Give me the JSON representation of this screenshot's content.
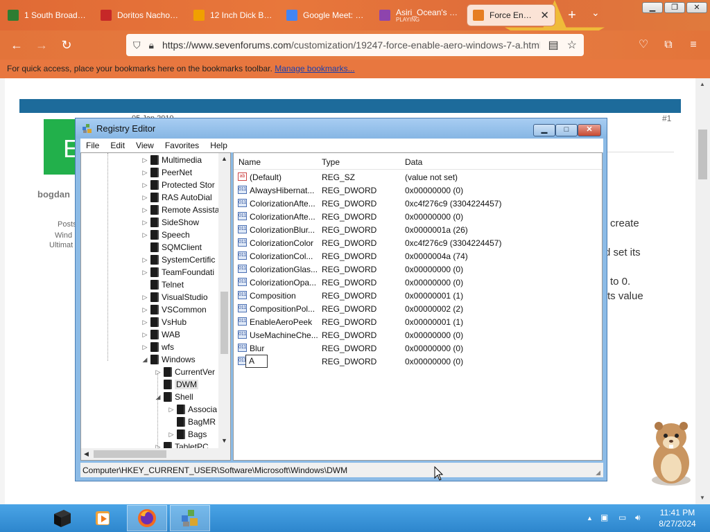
{
  "browser": {
    "tabs": [
      {
        "label": "1 South Broadway",
        "favicon": "green-square-icon",
        "color": "#2e7d32"
      },
      {
        "label": "Doritos Nacho Cheese",
        "favicon": "doritos-icon",
        "color": "#c62828"
      },
      {
        "label": "12 Inch Dick BBC",
        "favicon": "ph-icon",
        "color": "#f0a000"
      },
      {
        "label": "Google Meet: Online",
        "favicon": "google-icon",
        "color": "#4285f4"
      },
      {
        "label": "Asiri_Ocean's Room",
        "sublabel": "PLAYING",
        "favicon": "avatar-icon",
        "color": "#8e44ad"
      },
      {
        "label": "Force Enable Aero",
        "favicon": "sevenforums-icon",
        "color": "#e67e22",
        "active": true
      }
    ],
    "url_base": "https://www.sevenforums.com",
    "url_path": "/customization/19247-force-enable-aero-windows-7-a.html",
    "bookmarks_text": "For quick access, place your bookmarks here on the bookmarks toolbar.",
    "bookmarks_link": "Manage bookmarks..."
  },
  "page": {
    "post_number": "#1",
    "avatar_letter": "E",
    "date_partial": "05 Jan 2010",
    "username": "bogdan",
    "sidebar": [
      "Posts",
      "Wind",
      "Ultimat"
    ],
    "text_fragments": [
      "create",
      "d set its",
      "to 0.",
      "ts value"
    ]
  },
  "regedit": {
    "title": "Registry Editor",
    "menu": [
      "File",
      "Edit",
      "View",
      "Favorites",
      "Help"
    ],
    "tree": [
      {
        "label": "Multimedia",
        "depth": 0,
        "arrow": "▷"
      },
      {
        "label": "PeerNet",
        "depth": 0,
        "arrow": "▷"
      },
      {
        "label": "Protected Stor",
        "depth": 0,
        "arrow": "▷"
      },
      {
        "label": "RAS AutoDial",
        "depth": 0,
        "arrow": "▷"
      },
      {
        "label": "Remote Assista",
        "depth": 0,
        "arrow": "▷"
      },
      {
        "label": "SideShow",
        "depth": 0,
        "arrow": "▷"
      },
      {
        "label": "Speech",
        "depth": 0,
        "arrow": "▷"
      },
      {
        "label": "SQMClient",
        "depth": 0,
        "arrow": ""
      },
      {
        "label": "SystemCertific",
        "depth": 0,
        "arrow": "▷"
      },
      {
        "label": "TeamFoundati",
        "depth": 0,
        "arrow": "▷"
      },
      {
        "label": "Telnet",
        "depth": 0,
        "arrow": ""
      },
      {
        "label": "VisualStudio",
        "depth": 0,
        "arrow": "▷"
      },
      {
        "label": "VSCommon",
        "depth": 0,
        "arrow": "▷"
      },
      {
        "label": "VsHub",
        "depth": 0,
        "arrow": "▷"
      },
      {
        "label": "WAB",
        "depth": 0,
        "arrow": "▷"
      },
      {
        "label": "wfs",
        "depth": 0,
        "arrow": "▷"
      },
      {
        "label": "Windows",
        "depth": 0,
        "arrow": "◢"
      },
      {
        "label": "CurrentVer",
        "depth": 1,
        "arrow": "▷"
      },
      {
        "label": "DWM",
        "depth": 1,
        "arrow": "",
        "selected": true
      },
      {
        "label": "Shell",
        "depth": 1,
        "arrow": "◢"
      },
      {
        "label": "Associa",
        "depth": 2,
        "arrow": "▷"
      },
      {
        "label": "BagMR",
        "depth": 2,
        "arrow": ""
      },
      {
        "label": "Bags",
        "depth": 2,
        "arrow": "▷"
      },
      {
        "label": "TabletPC",
        "depth": 1,
        "arrow": "▷"
      }
    ],
    "columns": {
      "name": "Name",
      "type": "Type",
      "data": "Data"
    },
    "values": [
      {
        "name": "(Default)",
        "type": "REG_SZ",
        "data": "(value not set)",
        "icon": "string-value-icon"
      },
      {
        "name": "AlwaysHibernat...",
        "type": "REG_DWORD",
        "data": "0x00000000 (0)",
        "icon": "binary-value-icon"
      },
      {
        "name": "ColorizationAfte...",
        "type": "REG_DWORD",
        "data": "0xc4f276c9 (3304224457)",
        "icon": "binary-value-icon"
      },
      {
        "name": "ColorizationAfte...",
        "type": "REG_DWORD",
        "data": "0x00000000 (0)",
        "icon": "binary-value-icon"
      },
      {
        "name": "ColorizationBlur...",
        "type": "REG_DWORD",
        "data": "0x0000001a (26)",
        "icon": "binary-value-icon"
      },
      {
        "name": "ColorizationColor",
        "type": "REG_DWORD",
        "data": "0xc4f276c9 (3304224457)",
        "icon": "binary-value-icon"
      },
      {
        "name": "ColorizationCol...",
        "type": "REG_DWORD",
        "data": "0x0000004a (74)",
        "icon": "binary-value-icon"
      },
      {
        "name": "ColorizationGlas...",
        "type": "REG_DWORD",
        "data": "0x00000000 (0)",
        "icon": "binary-value-icon"
      },
      {
        "name": "ColorizationOpa...",
        "type": "REG_DWORD",
        "data": "0x00000000 (0)",
        "icon": "binary-value-icon"
      },
      {
        "name": "Composition",
        "type": "REG_DWORD",
        "data": "0x00000001 (1)",
        "icon": "binary-value-icon"
      },
      {
        "name": "CompositionPol...",
        "type": "REG_DWORD",
        "data": "0x00000002 (2)",
        "icon": "binary-value-icon"
      },
      {
        "name": "EnableAeroPeek",
        "type": "REG_DWORD",
        "data": "0x00000001 (1)",
        "icon": "binary-value-icon"
      },
      {
        "name": "UseMachineChe...",
        "type": "REG_DWORD",
        "data": "0x00000000 (0)",
        "icon": "binary-value-icon"
      },
      {
        "name": "Blur",
        "type": "REG_DWORD",
        "data": "0x00000000 (0)",
        "icon": "binary-value-icon"
      },
      {
        "name": "A",
        "type": "REG_DWORD",
        "data": "0x00000000 (0)",
        "icon": "binary-value-icon",
        "editing": true
      }
    ],
    "status_path": "Computer\\HKEY_CURRENT_USER\\Software\\Microsoft\\Windows\\DWM"
  },
  "taskbar": {
    "time": "11:41 PM",
    "date": "8/27/2024"
  }
}
